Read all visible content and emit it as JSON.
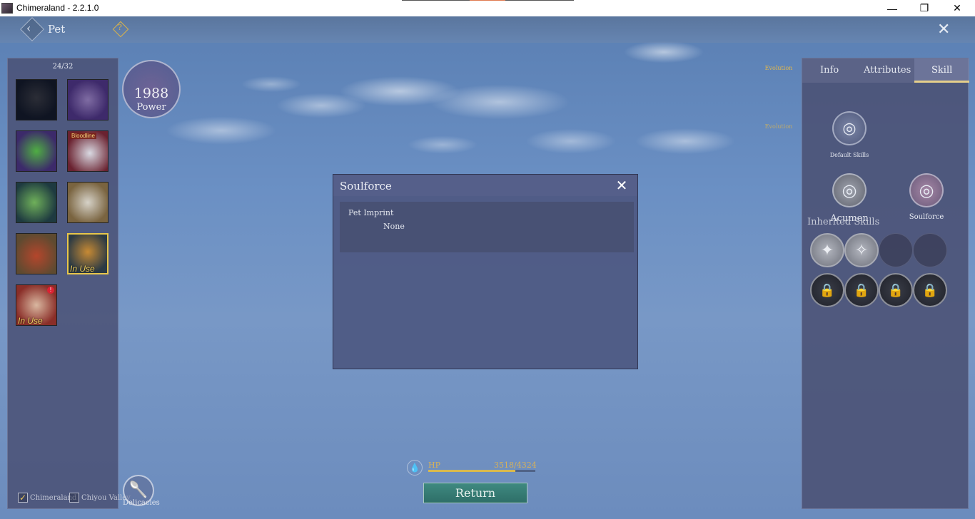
{
  "window": {
    "title": "Chimeraland - 2.2.1.0",
    "controls": {
      "minimize": "—",
      "restore": "❐",
      "close": "✕"
    }
  },
  "topbar": {
    "title": "Pet",
    "back_icon": "‹",
    "help_icon": "?",
    "close_icon": "✕"
  },
  "left_panel": {
    "count": "24/32",
    "pets": [
      {
        "name": "dark-boar",
        "in_use": false,
        "bloodline": false,
        "alert": false,
        "selected": false
      },
      {
        "name": "purple-shark",
        "in_use": false,
        "bloodline": false,
        "alert": false,
        "selected": false
      },
      {
        "name": "green-fish",
        "in_use": false,
        "bloodline": false,
        "alert": false,
        "selected": false
      },
      {
        "name": "white-dragon",
        "in_use": false,
        "bloodline": true,
        "alert": false,
        "selected": false
      },
      {
        "name": "green-lizard",
        "in_use": false,
        "bloodline": false,
        "alert": false,
        "selected": false
      },
      {
        "name": "dinosaur-skull",
        "in_use": false,
        "bloodline": false,
        "alert": false,
        "selected": false
      },
      {
        "name": "red-bird",
        "in_use": false,
        "bloodline": false,
        "alert": false,
        "selected": false
      },
      {
        "name": "yellow-bird",
        "in_use": true,
        "bloodline": false,
        "alert": false,
        "selected": true
      },
      {
        "name": "red-creature",
        "in_use": true,
        "bloodline": false,
        "alert": true,
        "selected": false
      }
    ],
    "in_use_label": "In Use",
    "bloodline_label": "Bloodline",
    "alert_symbol": "!",
    "filters": [
      {
        "label": "Chimeraland",
        "checked": true
      },
      {
        "label": "Chiyou Valley",
        "checked": false
      }
    ],
    "check_mark": "✓"
  },
  "delicacies": {
    "label": "Delicacies",
    "icon": "🥄"
  },
  "power": {
    "value": "1988",
    "label": "Power"
  },
  "evolution_tags": [
    "Evolution",
    "Evolution"
  ],
  "right_panel": {
    "tabs": [
      "Info",
      "Attributes",
      "Skill"
    ],
    "active_tab": "Skill",
    "default_skills_label": "Default Skills",
    "acumen_label": "Acumen",
    "soulforce_label": "Soulforce",
    "inherited_label": "Inherited Skills",
    "skill_icon": "◎",
    "inherited_slots": [
      {
        "state": "filled",
        "icon": "✦"
      },
      {
        "state": "filled",
        "icon": "✧"
      },
      {
        "state": "empty",
        "icon": ""
      },
      {
        "state": "empty",
        "icon": ""
      },
      {
        "state": "locked",
        "icon": "🔒"
      },
      {
        "state": "locked",
        "icon": "🔒"
      },
      {
        "state": "locked",
        "icon": "🔒"
      },
      {
        "state": "locked",
        "icon": "🔒"
      }
    ]
  },
  "dialog": {
    "title": "Soulforce",
    "close_icon": "✕",
    "imprint_label": "Pet Imprint",
    "imprint_value": "None"
  },
  "hp": {
    "label": "HP",
    "value": "3518/4324",
    "fraction": 0.8136,
    "icon": "💧"
  },
  "return_label": "Return",
  "colors": {
    "accent_gold": "#e8c64a",
    "return_green": "#3f8a80",
    "panel": "#4b5276"
  }
}
